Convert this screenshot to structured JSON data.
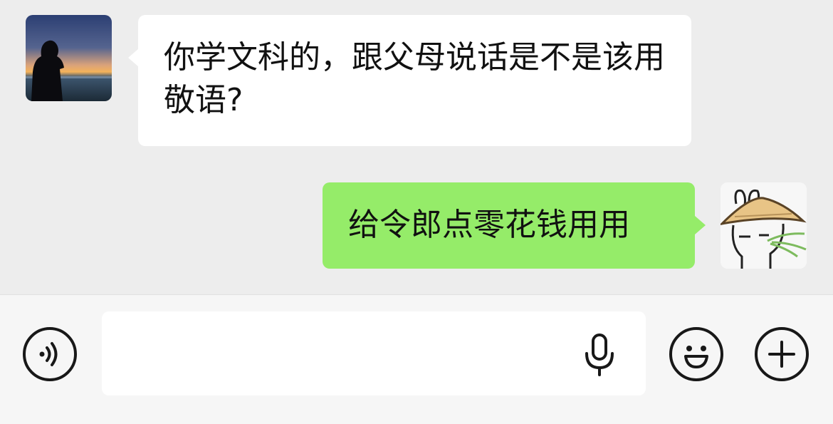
{
  "messages": [
    {
      "sender": "other",
      "text": "你学文科的，跟父母说话是不是该用敬语?"
    },
    {
      "sender": "self",
      "text": "给令郎点零花钱用用"
    }
  ],
  "input": {
    "value": "",
    "placeholder": ""
  },
  "icons": {
    "voice": "voice-icon",
    "mic": "mic-icon",
    "emoji": "emoji-icon",
    "more": "plus-icon"
  },
  "colors": {
    "background": "#ededed",
    "incoming_bubble": "#ffffff",
    "outgoing_bubble": "#95ec69",
    "input_bar": "#f6f6f6"
  }
}
